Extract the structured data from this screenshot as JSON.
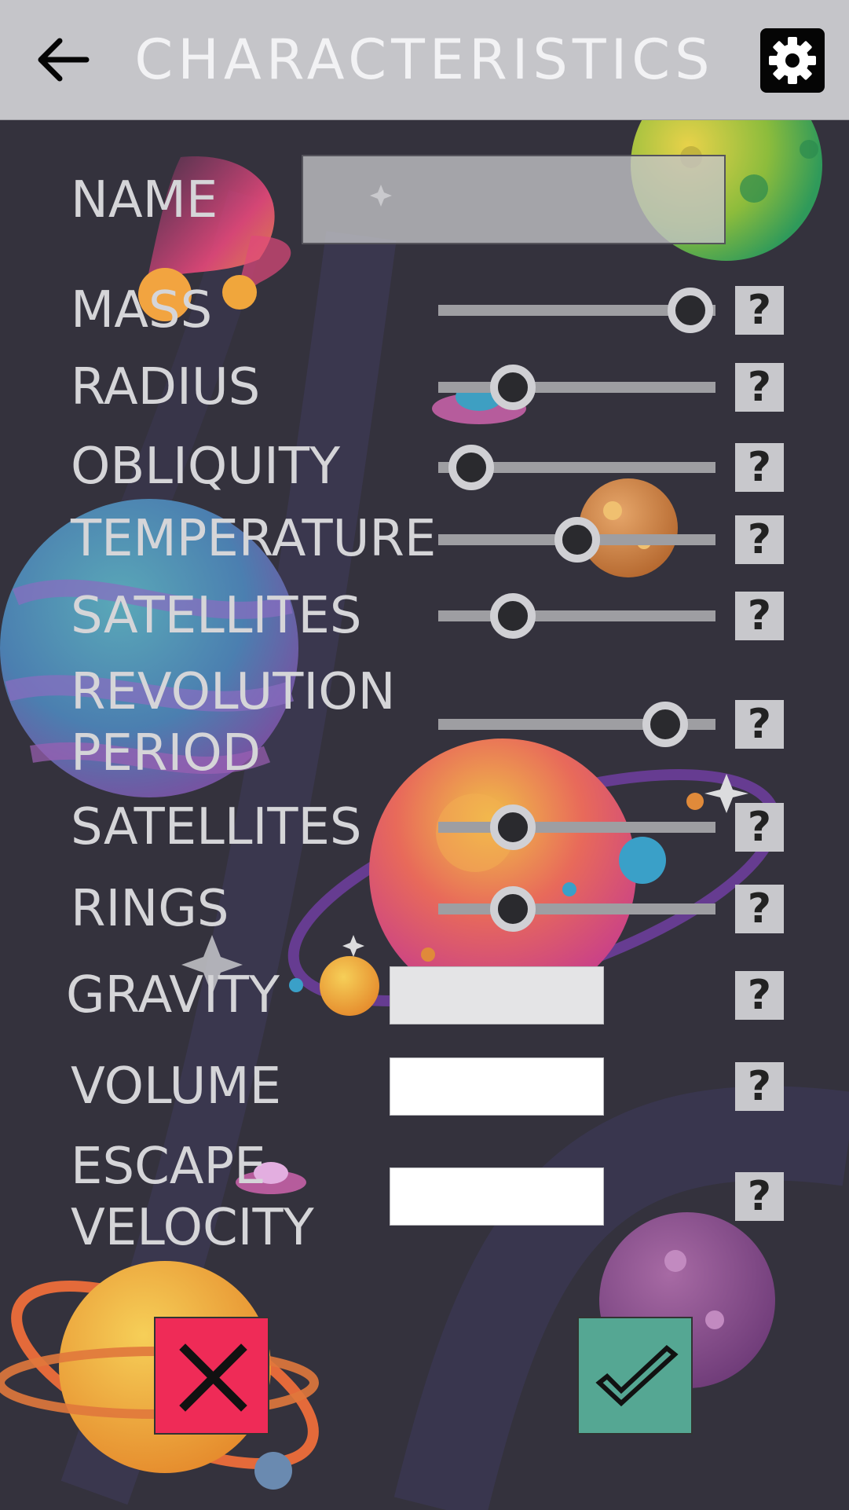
{
  "header": {
    "title": "CHARACTERISTICS",
    "back_icon": "arrow-left-icon",
    "settings_icon": "gear-icon"
  },
  "form": {
    "name": {
      "label": "NAME",
      "value": ""
    },
    "sliders": [
      {
        "id": "mass",
        "label": "MASS",
        "value": 0.91
      },
      {
        "id": "radius",
        "label": "RADIUS",
        "value": 0.27
      },
      {
        "id": "obliquity",
        "label": "OBLIQUITY",
        "value": 0.12
      },
      {
        "id": "temperature",
        "label": "TEMPERATURE",
        "value": 0.5
      },
      {
        "id": "satellites",
        "label": "SATELLITES",
        "value": 0.27
      },
      {
        "id": "revolution-period",
        "label_line1": "REVOLUTION",
        "label_line2": "PERIOD",
        "value": 0.82
      },
      {
        "id": "satellites-2",
        "label": "SATELLITES",
        "value": 0.27
      },
      {
        "id": "rings",
        "label": "RINGS",
        "value": 0.27
      }
    ],
    "gravity": {
      "label": "GRAVITY",
      "value": ""
    },
    "volume": {
      "label": "VOLUME",
      "value": ""
    },
    "escape_velocity": {
      "label_line1": "ESCAPE",
      "label_line2": "VELOCITY",
      "value": ""
    },
    "help_label": "?"
  },
  "actions": {
    "cancel_icon": "close-icon",
    "confirm_icon": "checkmark-icon"
  },
  "colors": {
    "background": "#34323d",
    "header": "#c5c5c9",
    "cancel": "#ef2b57",
    "confirm": "#55a793"
  }
}
